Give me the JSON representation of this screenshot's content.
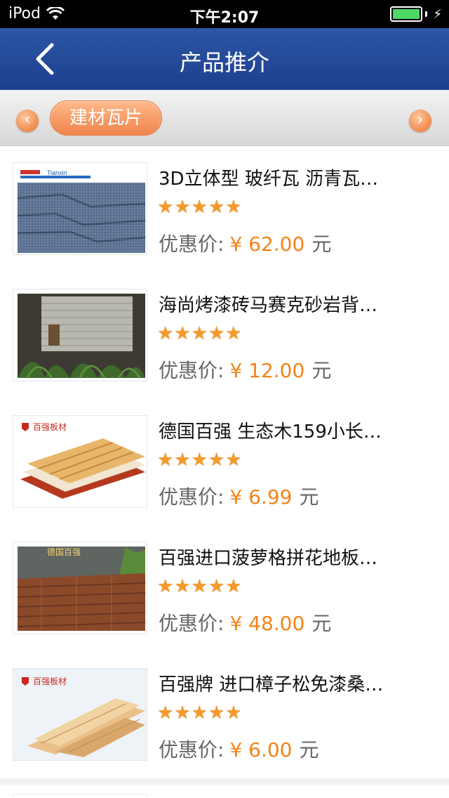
{
  "status_bar": {
    "carrier": "iPod",
    "time": "下午2:07",
    "battery_level": 1.0
  },
  "nav": {
    "title": "产品推介",
    "back_icon": "chevron-left-icon"
  },
  "category": {
    "selected": "建材瓦片",
    "left_arrow": "‹",
    "right_arrow": "›"
  },
  "products": [
    {
      "title": "3D立体型 玻纤瓦 沥青瓦…",
      "rating": 5,
      "price_label": "优惠价:",
      "price": "¥ 62.00",
      "unit": "元",
      "thumb_text": "Tianxin"
    },
    {
      "title": "海尚烤漆砖马赛克砂岩背…",
      "rating": 5,
      "price_label": "优惠价:",
      "price": "¥ 12.00",
      "unit": "元",
      "thumb_text": ""
    },
    {
      "title": "德国百强 生态木159小长…",
      "rating": 5,
      "price_label": "优惠价:",
      "price": "¥ 6.99",
      "unit": "元",
      "thumb_text": "百强板材"
    },
    {
      "title": "百强进口菠萝格拼花地板…",
      "rating": 5,
      "price_label": "优惠价:",
      "price": "¥ 48.00",
      "unit": "元",
      "thumb_text": "德国百强"
    },
    {
      "title": "百强牌 进口樟子松免漆桑…",
      "rating": 5,
      "price_label": "优惠价:",
      "price": "¥ 6.00",
      "unit": "元",
      "thumb_text": "百强板材"
    }
  ],
  "star_glyph": "★",
  "colors": {
    "nav_blue": "#2d56a6",
    "accent_orange": "#f28418",
    "star": "#f39a2c"
  }
}
